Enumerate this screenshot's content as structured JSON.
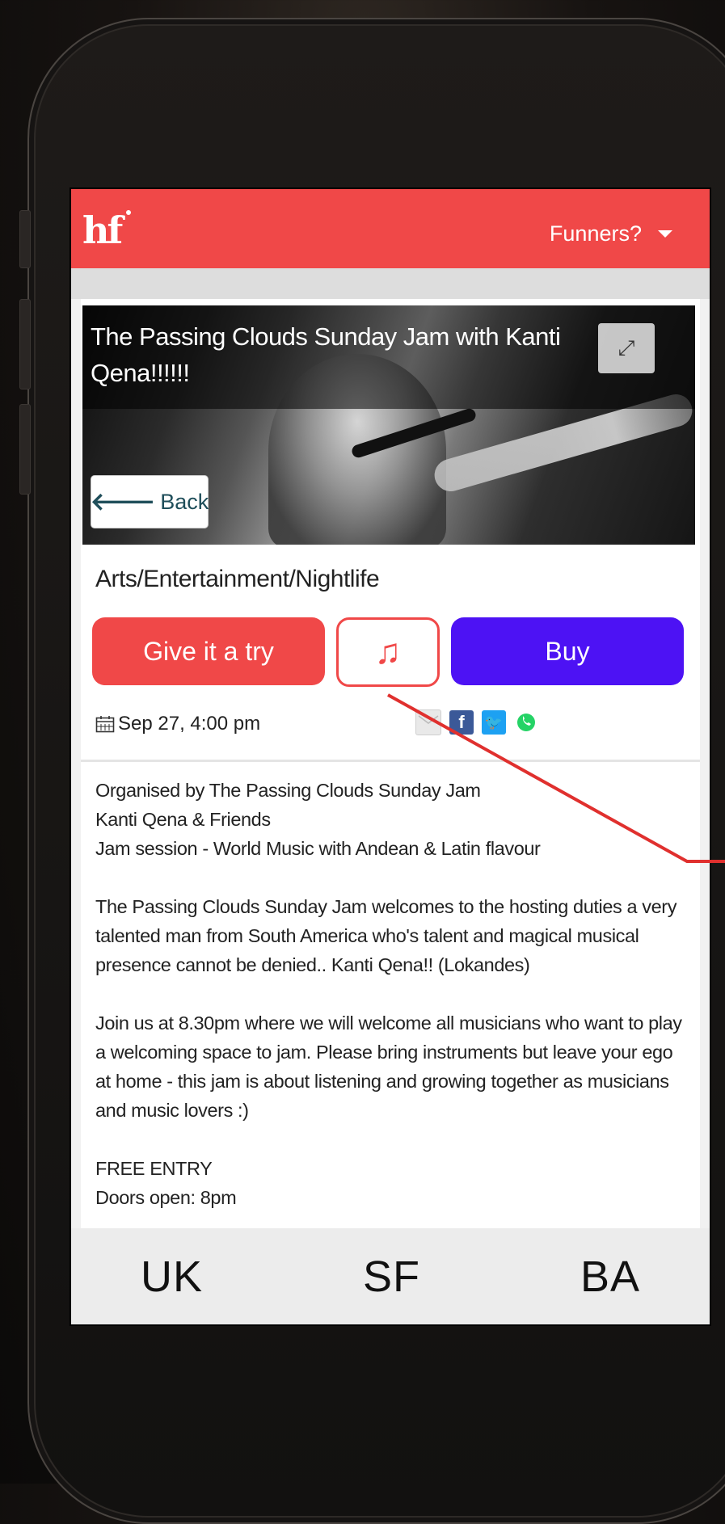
{
  "header": {
    "logo": "hf",
    "user_menu_label": "Funners?"
  },
  "event": {
    "title": "The Passing Clouds Sunday Jam with Kanti Qena!!!!!!",
    "back_label": "Back",
    "category": "Arts/Entertainment/Nightlife",
    "actions": {
      "try_label": "Give it a try",
      "music_icon": "music-note-icon",
      "buy_label": "Buy"
    },
    "date": "Sep 27, 4:00 pm",
    "share": [
      "email-icon",
      "facebook-icon",
      "twitter-icon",
      "whatsapp-icon"
    ],
    "description": [
      "Organised by The Passing Clouds Sunday Jam\nKanti Qena & Friends\nJam session - World Music with Andean & Latin flavour",
      "The Passing Clouds Sunday Jam welcomes to the hosting duties a very talented man from South America who's talent and magical musical presence cannot be denied.. Kanti Qena!! (Lokandes)",
      "Join us at 8.30pm where we will welcome all musicians who want to play a welcoming space to jam. Please bring instruments but leave your ego at home - this jam is about listening and growing together as musicians and music lovers :)",
      "FREE ENTRY\nDoors open: 8pm"
    ]
  },
  "bottom_nav": {
    "items": [
      "UK",
      "SF",
      "BA"
    ]
  },
  "colors": {
    "brand_red": "#f04848",
    "buy_purple": "#4d12f4",
    "pointer_red": "#e0302e"
  }
}
